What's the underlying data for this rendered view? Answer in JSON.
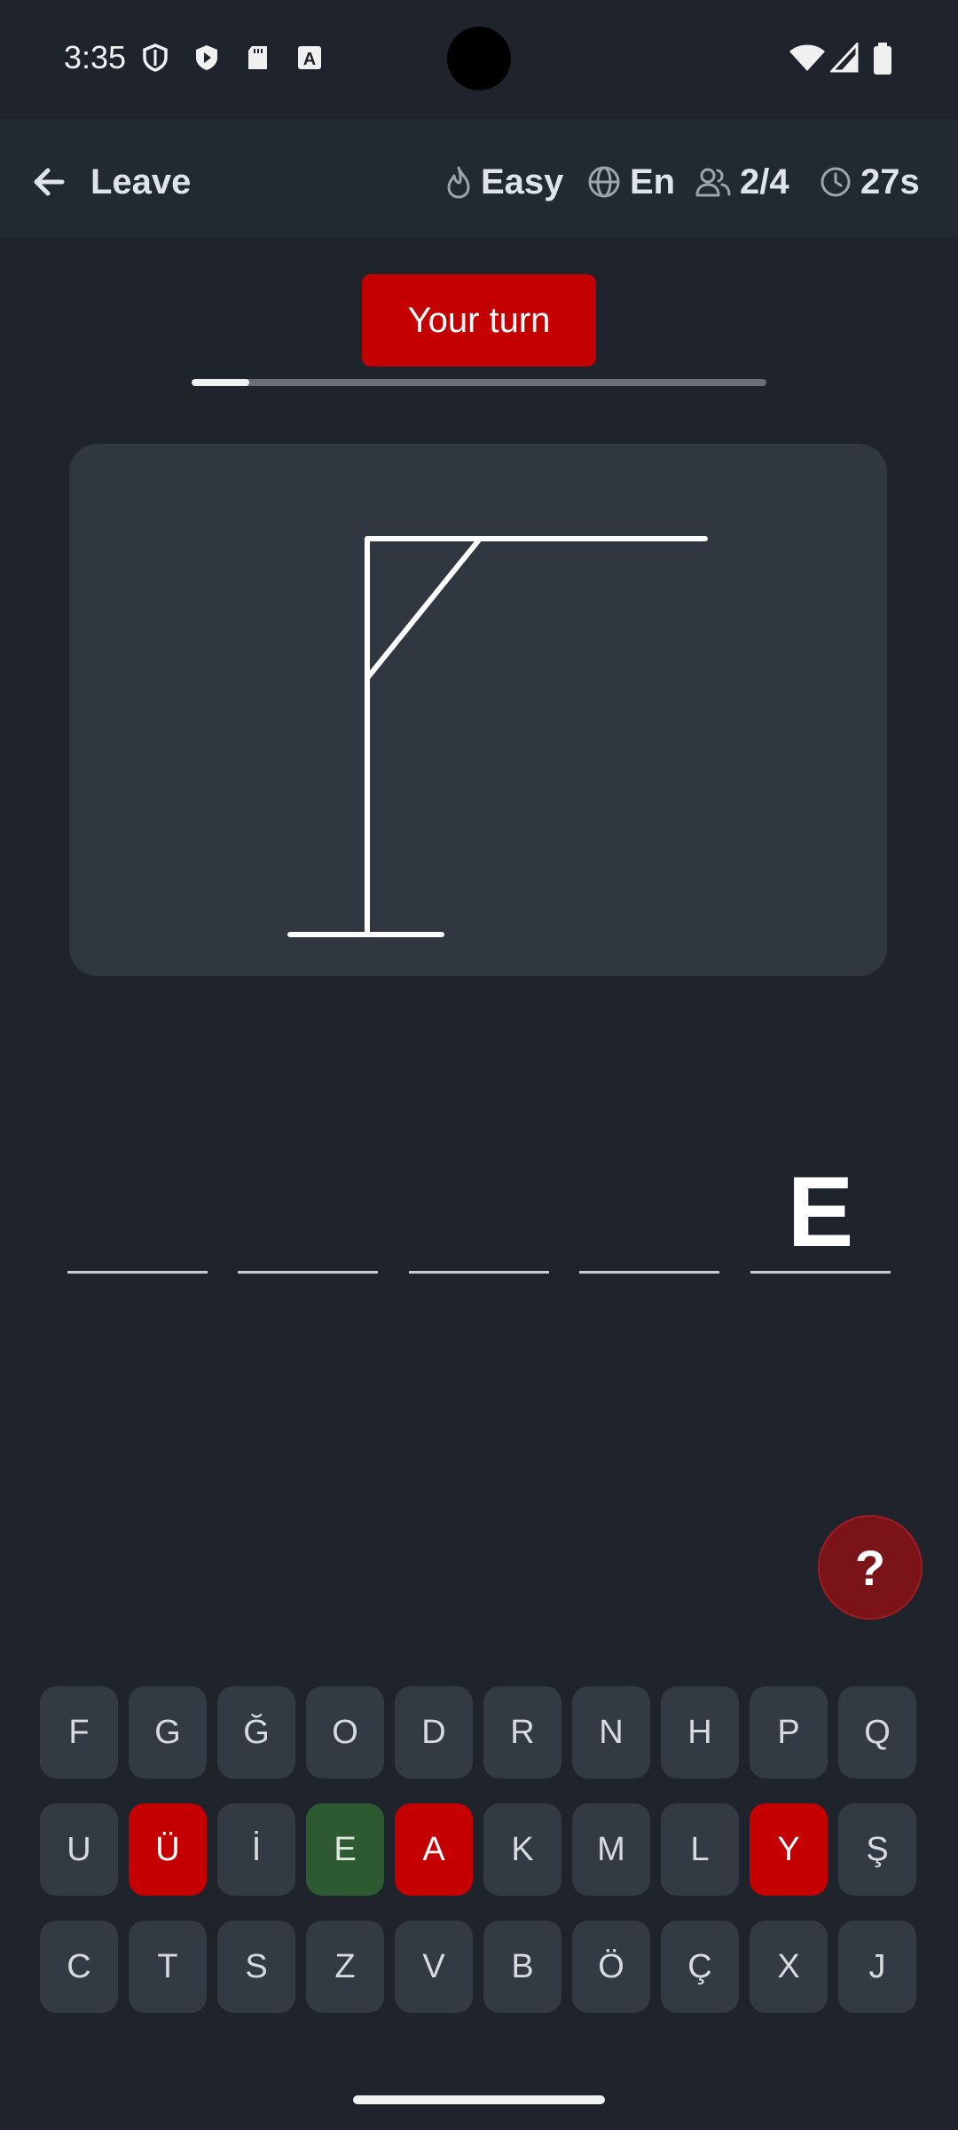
{
  "status_bar": {
    "time": "3:35",
    "icons": [
      "shield-icon",
      "play-shield-icon",
      "sd-card-icon",
      "font-icon"
    ],
    "right_icons": [
      "wifi-icon",
      "signal-icon",
      "battery-icon"
    ]
  },
  "top_bar": {
    "back_label": "Leave",
    "difficulty": "Easy",
    "language": "En",
    "players": "2/4",
    "timer": "27s"
  },
  "turn": {
    "label": "Your turn",
    "progress": 0.1,
    "accent_color": "#c40000"
  },
  "gallows": {
    "stage": 1
  },
  "word": {
    "slots": [
      "",
      "",
      "",
      "",
      "E"
    ]
  },
  "help": {
    "label": "?"
  },
  "keyboard": {
    "rows": [
      [
        {
          "letter": "F",
          "state": "unused"
        },
        {
          "letter": "G",
          "state": "unused"
        },
        {
          "letter": "Ğ",
          "state": "unused"
        },
        {
          "letter": "O",
          "state": "unused"
        },
        {
          "letter": "D",
          "state": "unused"
        },
        {
          "letter": "R",
          "state": "unused"
        },
        {
          "letter": "N",
          "state": "unused"
        },
        {
          "letter": "H",
          "state": "unused"
        },
        {
          "letter": "P",
          "state": "unused"
        },
        {
          "letter": "Q",
          "state": "unused"
        }
      ],
      [
        {
          "letter": "U",
          "state": "unused"
        },
        {
          "letter": "Ü",
          "state": "wrong"
        },
        {
          "letter": "İ",
          "state": "unused"
        },
        {
          "letter": "E",
          "state": "correct"
        },
        {
          "letter": "A",
          "state": "wrong"
        },
        {
          "letter": "K",
          "state": "unused"
        },
        {
          "letter": "M",
          "state": "unused"
        },
        {
          "letter": "L",
          "state": "unused"
        },
        {
          "letter": "Y",
          "state": "wrong"
        },
        {
          "letter": "Ş",
          "state": "unused"
        }
      ],
      [
        {
          "letter": "C",
          "state": "unused"
        },
        {
          "letter": "T",
          "state": "unused"
        },
        {
          "letter": "S",
          "state": "unused"
        },
        {
          "letter": "Z",
          "state": "unused"
        },
        {
          "letter": "V",
          "state": "unused"
        },
        {
          "letter": "B",
          "state": "unused"
        },
        {
          "letter": "Ö",
          "state": "unused"
        },
        {
          "letter": "Ç",
          "state": "unused"
        },
        {
          "letter": "X",
          "state": "unused"
        },
        {
          "letter": "J",
          "state": "unused"
        }
      ]
    ],
    "colors": {
      "unused": "#333a43",
      "wrong": "#c40000",
      "correct": "#2e5a32"
    }
  }
}
